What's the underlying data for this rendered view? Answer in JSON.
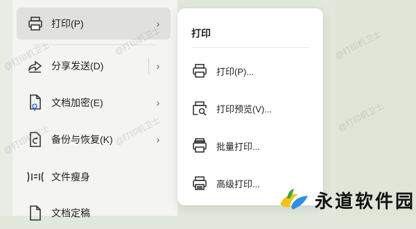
{
  "main_menu": {
    "items": [
      {
        "label": "打印(P)",
        "icon": "printer-icon",
        "has_submenu": true,
        "active": true
      },
      {
        "label": "分享发送(D)",
        "icon": "share-icon",
        "has_submenu": true
      },
      {
        "label": "文档加密(E)",
        "icon": "document-lock-icon",
        "has_submenu": true
      },
      {
        "label": "备份与恢复(K)",
        "icon": "backup-icon",
        "has_submenu": true
      },
      {
        "label": "文件瘦身",
        "icon": "file-slim-icon",
        "has_submenu": false
      },
      {
        "label": "文档定稿",
        "icon": "document-final-icon",
        "has_submenu": false
      }
    ]
  },
  "submenu": {
    "title": "打印",
    "items": [
      {
        "label": "打印(P)...",
        "icon": "printer-icon"
      },
      {
        "label": "打印预览(V)...",
        "icon": "print-preview-icon"
      },
      {
        "label": "批量打印...",
        "icon": "batch-print-icon"
      },
      {
        "label": "高级打印...",
        "icon": "advanced-print-icon"
      }
    ]
  },
  "chevron": "›",
  "watermark_text": "@打印机卫士",
  "brand_logo_text": "永道软件园"
}
